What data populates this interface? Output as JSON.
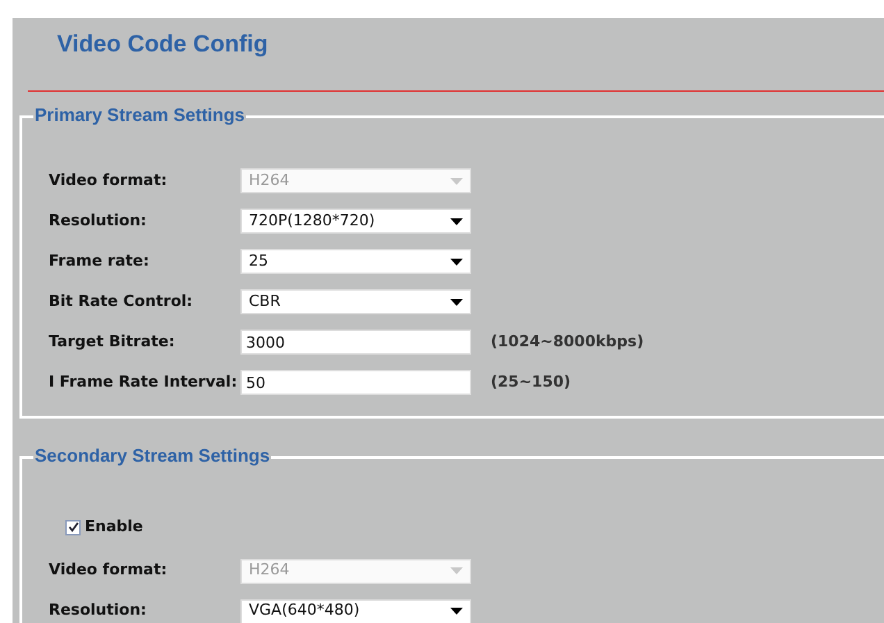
{
  "title": "Video Code Config",
  "sections": [
    {
      "legend": "Primary Stream Settings",
      "fields": [
        {
          "kind": "select",
          "label": "Video format:",
          "value": "H264",
          "disabled": true
        },
        {
          "kind": "select",
          "label": "Resolution:",
          "value": "720P(1280*720)",
          "disabled": false
        },
        {
          "kind": "select",
          "label": "Frame rate:",
          "value": "25",
          "disabled": false
        },
        {
          "kind": "select",
          "label": "Bit Rate Control:",
          "value": "CBR",
          "disabled": false
        },
        {
          "kind": "input",
          "label": "Target Bitrate:",
          "value": "3000",
          "hint": "(1024~8000kbps)"
        },
        {
          "kind": "input",
          "label": "I Frame Rate Interval:",
          "value": "50",
          "hint": "(25~150)"
        }
      ]
    },
    {
      "legend": "Secondary Stream Settings",
      "enable": {
        "label": "Enable",
        "checked": true
      },
      "fields": [
        {
          "kind": "select",
          "label": "Video format:",
          "value": "H264",
          "disabled": true
        },
        {
          "kind": "select",
          "label": "Resolution:",
          "value": "VGA(640*480)",
          "disabled": false
        }
      ]
    }
  ]
}
